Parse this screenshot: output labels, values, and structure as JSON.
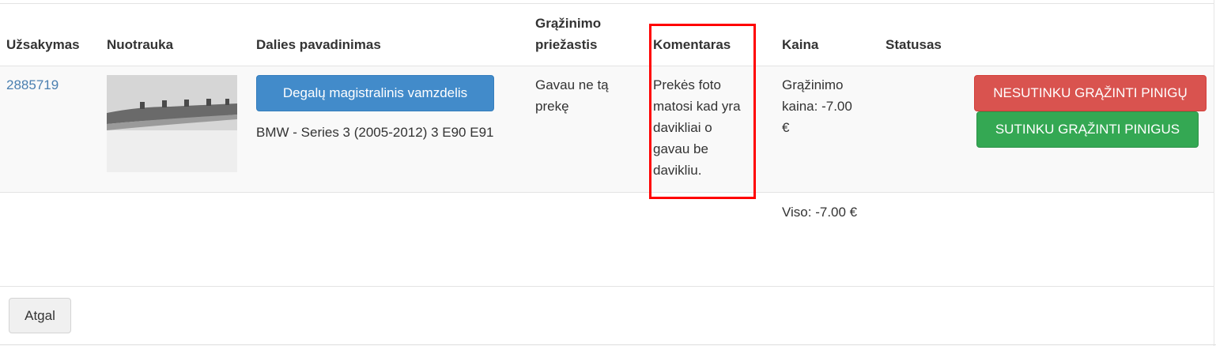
{
  "table": {
    "headers": {
      "order": "Užsakymas",
      "photo": "Nuotrauka",
      "part_name": "Dalies pavadinimas",
      "reason_line1": "Grąžinimo",
      "reason_line2": "priežastis",
      "comment": "Komentaras",
      "price": "Kaina",
      "status": "Statusas"
    },
    "row": {
      "order_number": "2885719",
      "part_button": "Degalų magistralinis vamzdelis",
      "car_model": "BMW - Series 3 (2005-2012) 3 E90 E91",
      "reason_lines": [
        "Gavau ne tą",
        "prekę"
      ],
      "comment_lines": [
        "Prekės foto",
        "matosi kad yra",
        "davikliai o",
        "gavau be",
        "davikliu."
      ],
      "price_lines": [
        "Grąžinimo",
        "kaina: -7.00",
        "€"
      ],
      "status": "",
      "reject_button": "NESUTINKU GRĄŽINTI PINIGŲ",
      "accept_button": "SUTINKU GRĄŽINTI PINIGUS"
    },
    "total": "Viso: -7.00 €"
  },
  "footer": {
    "back_button": "Atgal"
  },
  "colors": {
    "link": "#4a7fb0",
    "primary": "#428bca",
    "danger": "#d9534f",
    "success": "#34a853",
    "highlight": "#ff0000"
  },
  "icons": {
    "photo": "part-photo-thumbnail"
  }
}
